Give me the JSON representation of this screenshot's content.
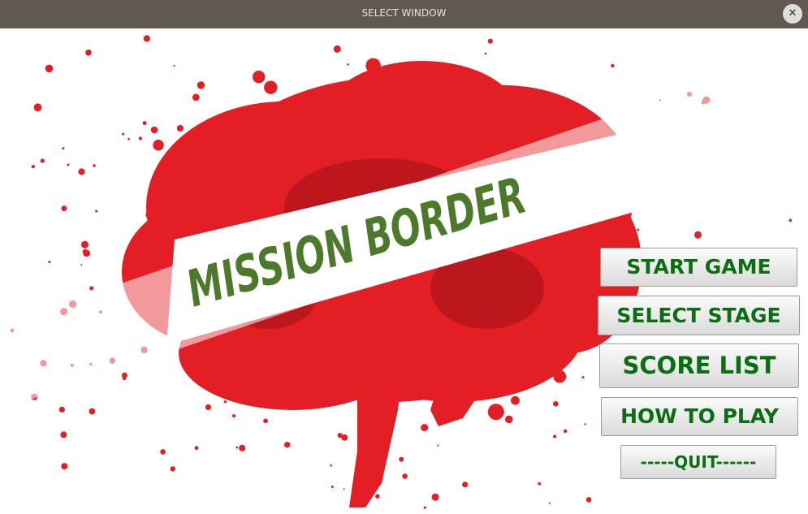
{
  "window": {
    "title": "SELECT WINDOW",
    "close_glyph": "✕"
  },
  "game": {
    "logo_text": "MISSION BORDER"
  },
  "menu": {
    "start_label": "START GAME",
    "select_label": "SELECT STAGE",
    "score_label": "SCORE LIST",
    "howto_label": "HOW TO PLAY",
    "quit_label": "-----QUIT------"
  },
  "colors": {
    "titlebar": "#615852",
    "blood": "#e31e24",
    "blood_dark": "#b0151b",
    "logo_text": "#4d7a2a",
    "button_text": "#0b6e12"
  }
}
